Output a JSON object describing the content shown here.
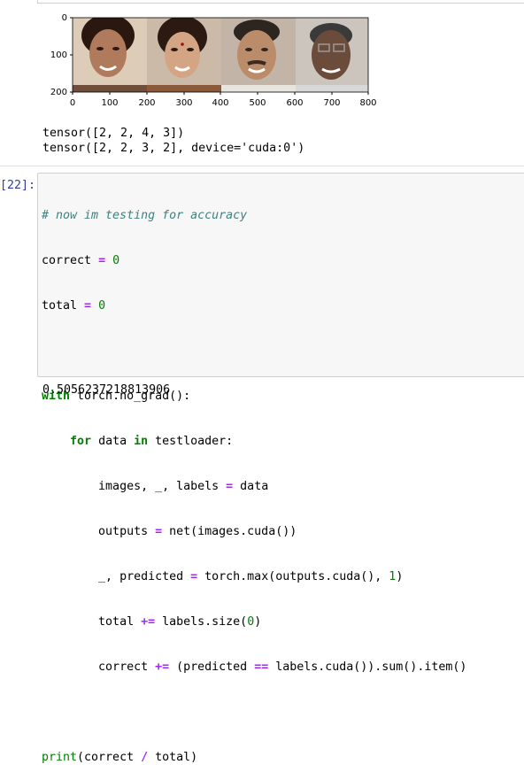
{
  "figure": {
    "y_ticks": [
      "0",
      "100",
      "200"
    ],
    "x_ticks": [
      "0",
      "100",
      "200",
      "300",
      "400",
      "500",
      "600",
      "700",
      "800"
    ],
    "images": [
      {
        "name": "face-1",
        "skin": "#b07a5c",
        "bg": "#d9c9b6",
        "hair": "#2a1810"
      },
      {
        "name": "face-2",
        "skin": "#d0a080",
        "bg": "#c9b8a6",
        "hair": "#2b1a12"
      },
      {
        "name": "face-3",
        "skin": "#b98a68",
        "bg": "#bfb1a4",
        "hair": "#2d2520"
      },
      {
        "name": "face-4",
        "skin": "#6b4b3a",
        "bg": "#c8c2ba",
        "hair": "#3a3a3a"
      }
    ]
  },
  "output": {
    "line1": "tensor([2, 2, 4, 3])",
    "line2": "tensor([2, 2, 3, 2], device='cuda:0')"
  },
  "cell": {
    "prompt": "[22]:",
    "code": {
      "comment": "# now im testing for accuracy",
      "l2_var": "correct",
      "l2_op": "=",
      "l2_num": "0",
      "l3_var": "total",
      "l3_op": "=",
      "l3_num": "0",
      "l5_kw": "with",
      "l5_rest": " torch.no_grad():",
      "l6_kw1": "for",
      "l6_mid": " data ",
      "l6_kw2": "in",
      "l6_rest": " testloader:",
      "l7_a": "images, _, labels ",
      "l7_op": "=",
      "l7_b": " data",
      "l8_a": "outputs ",
      "l8_op": "=",
      "l8_b": " net(images.cuda())",
      "l9_a": "_, predicted ",
      "l9_op": "=",
      "l9_b": " torch.max(outputs.cuda(), ",
      "l9_num": "1",
      "l9_c": ")",
      "l10_a": "total ",
      "l10_op": "+=",
      "l10_b": " labels.size(",
      "l10_num": "0",
      "l10_c": ")",
      "l11_a": "correct ",
      "l11_op": "+=",
      "l11_b": " (predicted ",
      "l11_op2": "==",
      "l11_c": " labels.cuda()).sum().item()",
      "l13_bi": "print",
      "l13_a": "(correct ",
      "l13_op": "/",
      "l13_b": " total)"
    },
    "result": "0.5056237218813906"
  }
}
